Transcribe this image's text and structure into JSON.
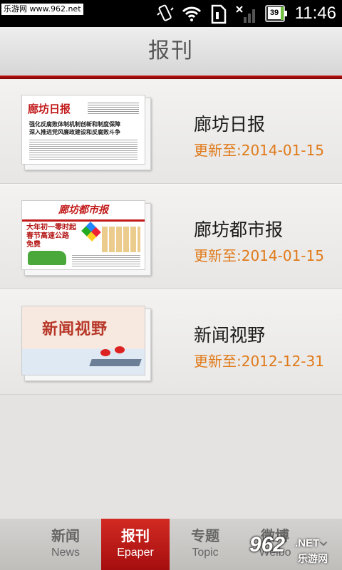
{
  "status_bar": {
    "watermark": "乐游网 www.962.net",
    "battery_level": "39",
    "time": "11:46"
  },
  "header": {
    "title": "报刊"
  },
  "papers": [
    {
      "name": "廊坊日报",
      "updated": "更新至:2014-01-15",
      "thumb_masthead": "廊坊日报",
      "thumb_headline1": "强化反腐败体制机制创新和制度保障",
      "thumb_headline2": "深入推进党风廉政建设和反腐败斗争"
    },
    {
      "name": "廊坊都市报",
      "updated": "更新至:2014-01-15",
      "thumb_masthead": "廊坊都市报",
      "thumb_headline1": "大年初一零时起",
      "thumb_headline2": "春节高速公路",
      "thumb_headline3": "免费"
    },
    {
      "name": "新闻视野",
      "updated": "更新至:2012-12-31",
      "thumb_masthead": "新闻视野"
    }
  ],
  "tabs": [
    {
      "cn": "新闻",
      "en": "News"
    },
    {
      "cn": "报刊",
      "en": "Epaper"
    },
    {
      "cn": "专题",
      "en": "Topic"
    },
    {
      "cn": "微博",
      "en": "Weibo"
    }
  ],
  "bottom_watermark": {
    "num": "962",
    "net": ".NET",
    "cn": "乐游网"
  },
  "colors": {
    "accent_red": "#b81212",
    "update_orange": "#e07a1a",
    "background": "#e4e3e1"
  }
}
